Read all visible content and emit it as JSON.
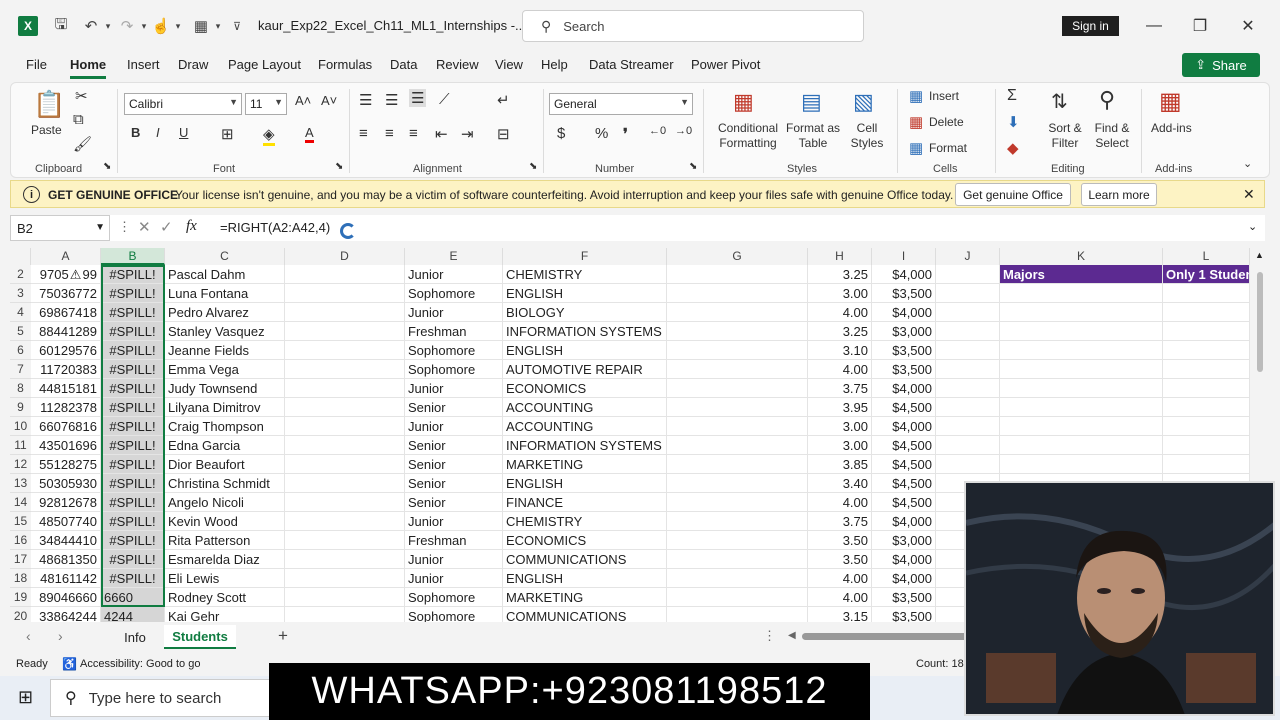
{
  "titlebar": {
    "filename": "kaur_Exp22_Excel_Ch11_ML1_Internships  -...",
    "search_placeholder": "Search",
    "signin": "Sign in"
  },
  "menu": [
    "File",
    "Home",
    "Insert",
    "Draw",
    "Page Layout",
    "Formulas",
    "Data",
    "Review",
    "View",
    "Help",
    "Data Streamer",
    "Power Pivot"
  ],
  "share": "Share",
  "ribbon": {
    "paste": "Paste",
    "clipboard": "Clipboard",
    "font_name": "Calibri",
    "font_size": "11",
    "font": "Font",
    "alignment": "Alignment",
    "number_format": "General",
    "number": "Number",
    "cond_format_1": "Conditional",
    "cond_format_2": "Formatting",
    "format_table_1": "Format as",
    "format_table_2": "Table",
    "cell_styles_1": "Cell",
    "cell_styles_2": "Styles",
    "styles": "Styles",
    "insert": "Insert",
    "delete": "Delete",
    "format": "Format",
    "cells": "Cells",
    "sort_1": "Sort &",
    "sort_2": "Filter",
    "find_1": "Find &",
    "find_2": "Select",
    "editing": "Editing",
    "addins": "Add-ins",
    "addins_group": "Add-ins"
  },
  "banner": {
    "title": "GET GENUINE OFFICE",
    "message": "Your license isn't genuine, and you may be a victim of software counterfeiting. Avoid interruption and keep your files safe with genuine Office today.",
    "get_btn": "Get genuine Office",
    "learn_btn": "Learn more"
  },
  "formula_bar": {
    "namebox": "B2",
    "formula": "=RIGHT(A2:A42,4)"
  },
  "columns": [
    "A",
    "B",
    "C",
    "D",
    "E",
    "F",
    "G",
    "H",
    "I",
    "J",
    "K",
    "L"
  ],
  "rows": [
    {
      "n": "2",
      "a": "9705 ⚠ 99",
      "b": "#SPILL!",
      "c": "Pascal Dahm",
      "e": "Junior",
      "f": "CHEMISTRY",
      "h": "3.25",
      "i": "$4,000",
      "k": "Majors",
      "l": "Only 1 Studen"
    },
    {
      "n": "3",
      "a": "75036772",
      "b": "#SPILL!",
      "c": "Luna Fontana",
      "e": "Sophomore",
      "f": "ENGLISH",
      "h": "3.00",
      "i": "$3,500"
    },
    {
      "n": "4",
      "a": "69867418",
      "b": "#SPILL!",
      "c": "Pedro Alvarez",
      "e": "Junior",
      "f": "BIOLOGY",
      "h": "4.00",
      "i": "$4,000"
    },
    {
      "n": "5",
      "a": "88441289",
      "b": "#SPILL!",
      "c": "Stanley Vasquez",
      "e": "Freshman",
      "f": "INFORMATION SYSTEMS",
      "h": "3.25",
      "i": "$3,000"
    },
    {
      "n": "6",
      "a": "60129576",
      "b": "#SPILL!",
      "c": "Jeanne Fields",
      "e": "Sophomore",
      "f": "ENGLISH",
      "h": "3.10",
      "i": "$3,500"
    },
    {
      "n": "7",
      "a": "11720383",
      "b": "#SPILL!",
      "c": "Emma Vega",
      "e": "Sophomore",
      "f": "AUTOMOTIVE REPAIR",
      "h": "4.00",
      "i": "$3,500"
    },
    {
      "n": "8",
      "a": "44815181",
      "b": "#SPILL!",
      "c": "Judy Townsend",
      "e": "Junior",
      "f": "ECONOMICS",
      "h": "3.75",
      "i": "$4,000"
    },
    {
      "n": "9",
      "a": "11282378",
      "b": "#SPILL!",
      "c": "Lilyana Dimitrov",
      "e": "Senior",
      "f": "ACCOUNTING",
      "h": "3.95",
      "i": "$4,500"
    },
    {
      "n": "10",
      "a": "66076816",
      "b": "#SPILL!",
      "c": "Craig Thompson",
      "e": "Junior",
      "f": "ACCOUNTING",
      "h": "3.00",
      "i": "$4,000"
    },
    {
      "n": "11",
      "a": "43501696",
      "b": "#SPILL!",
      "c": "Edna Garcia",
      "e": "Senior",
      "f": "INFORMATION SYSTEMS",
      "h": "3.00",
      "i": "$4,500"
    },
    {
      "n": "12",
      "a": "55128275",
      "b": "#SPILL!",
      "c": "Dior Beaufort",
      "e": "Senior",
      "f": "MARKETING",
      "h": "3.85",
      "i": "$4,500"
    },
    {
      "n": "13",
      "a": "50305930",
      "b": "#SPILL!",
      "c": "Christina Schmidt",
      "e": "Senior",
      "f": "ENGLISH",
      "h": "3.40",
      "i": "$4,500"
    },
    {
      "n": "14",
      "a": "92812678",
      "b": "#SPILL!",
      "c": "Angelo Nicoli",
      "e": "Senior",
      "f": "FINANCE",
      "h": "4.00",
      "i": "$4,500"
    },
    {
      "n": "15",
      "a": "48507740",
      "b": "#SPILL!",
      "c": "Kevin Wood",
      "e": "Junior",
      "f": "CHEMISTRY",
      "h": "3.75",
      "i": "$4,000"
    },
    {
      "n": "16",
      "a": "34844410",
      "b": "#SPILL!",
      "c": "Rita Patterson",
      "e": "Freshman",
      "f": "ECONOMICS",
      "h": "3.50",
      "i": "$3,000"
    },
    {
      "n": "17",
      "a": "48681350",
      "b": "#SPILL!",
      "c": "Esmarelda Diaz",
      "e": "Junior",
      "f": "COMMUNICATIONS",
      "h": "3.50",
      "i": "$4,000"
    },
    {
      "n": "18",
      "a": "48161142",
      "b": "#SPILL!",
      "c": "Eli Lewis",
      "e": "Junior",
      "f": "ENGLISH",
      "h": "4.00",
      "i": "$4,000"
    },
    {
      "n": "19",
      "a": "89046660",
      "b": "6660",
      "c": "Rodney Scott",
      "e": "Sophomore",
      "f": "MARKETING",
      "h": "4.00",
      "i": "$3,500"
    },
    {
      "n": "20",
      "a": "33864244",
      "b": "4244",
      "c": "Kai Gehr",
      "e": "Sophomore",
      "f": "COMMUNICATIONS",
      "h": "3.15",
      "i": "$3,500"
    }
  ],
  "sheets": {
    "info": "Info",
    "students": "Students"
  },
  "status": {
    "ready": "Ready",
    "accessibility": "Accessibility: Good to go",
    "count": "Count: 18"
  },
  "taskbar": {
    "search_placeholder": "Type here to search"
  },
  "overlay": {
    "whatsapp": "WHATSAPP:+923081198512"
  },
  "colors": {
    "excel_green": "#107c41",
    "header_purple": "#5c2a91",
    "banner_yellow": "#fdf3c4"
  }
}
